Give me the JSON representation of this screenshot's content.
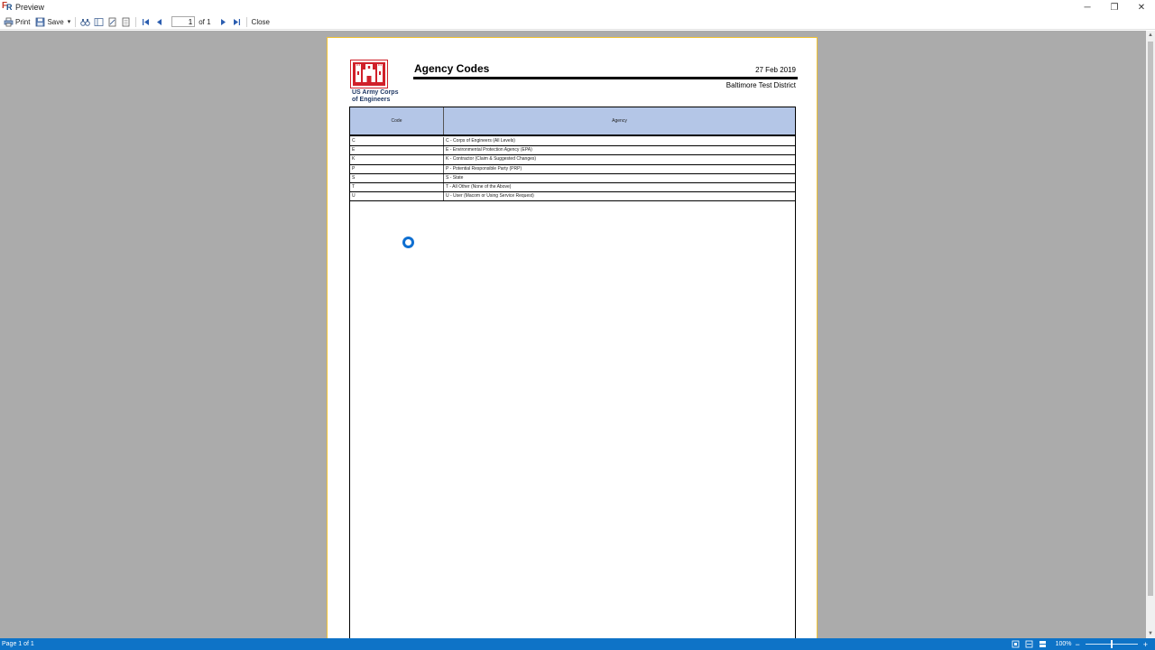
{
  "window": {
    "title": "Preview",
    "controls": {
      "minimize": "─",
      "restore": "❐",
      "close": "✕"
    }
  },
  "toolbar": {
    "print_label": "Print",
    "save_label": "Save",
    "save_dropdown": "▾",
    "page_input_value": "1",
    "page_of": "of 1",
    "close_label": "Close",
    "icons": [
      "printer-icon",
      "save-icon",
      "binoculars-icon",
      "layout-icon",
      "page-setup-icon",
      "export-icon",
      "first-page-icon",
      "previous-page-icon",
      "next-page-icon",
      "last-page-icon"
    ]
  },
  "report": {
    "title": "Agency Codes",
    "date": "27 Feb 2019",
    "district": "Baltimore Test District",
    "logo_line1": "US Army Corps",
    "logo_line2": "of Engineers",
    "columns": {
      "code": "Code",
      "agency": "Agency"
    },
    "rows": [
      {
        "code": "C",
        "agency": "C - Corps of Engineers (All Levels)"
      },
      {
        "code": "E",
        "agency": "E - Environmental Protection Agency (EPA)"
      },
      {
        "code": "K",
        "agency": "K - Contractor (Claim & Suggested Changes)"
      },
      {
        "code": "P",
        "agency": "P - Potential Responsible Party (PRP)"
      },
      {
        "code": "S",
        "agency": "S - State"
      },
      {
        "code": "T",
        "agency": "T - All Other (None of the Above)"
      },
      {
        "code": "U",
        "agency": "U - User (Macom or Using Service Request)"
      }
    ]
  },
  "status": {
    "page_info": "Page 1 of 1",
    "zoom": "100%",
    "zoom_out": "−",
    "zoom_in": "+",
    "zoom_level": 0.5
  },
  "colors": {
    "accent": "#0e73c7",
    "header_fill": "#b4c6e7",
    "logo_red": "#d0202a",
    "page_border": "#f1c232"
  }
}
